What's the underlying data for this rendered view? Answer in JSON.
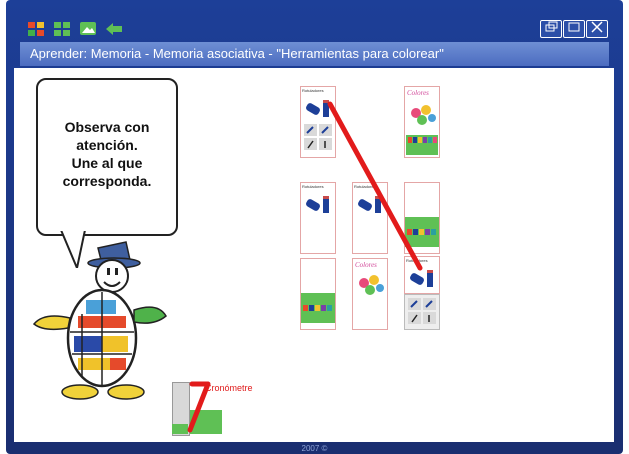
{
  "window": {
    "title": "Aprender: Memoria - Memoria asociativa - \"Herramientas para colorear\"",
    "footer": "2007 ©"
  },
  "toolbar": {
    "icons": [
      "grid-4-icon",
      "grid-4-green-icon",
      "image-icon",
      "back-arrow-icon"
    ]
  },
  "window_controls": [
    "restore-icon",
    "maximize-icon",
    "close-icon"
  ],
  "instructions": {
    "line1": "Observa con",
    "line2": "atención.",
    "line3": "Une al que",
    "line4": "corresponda."
  },
  "cards": {
    "rotuladores_label": "Rotuladores",
    "colores_label": "Colores"
  },
  "timer": {
    "label": "Cronómetre"
  },
  "colors": {
    "frame": "#1d3f98",
    "titlebar": "#5877c8",
    "line": "#e21b1b",
    "card_border": "#e4a6a6"
  }
}
